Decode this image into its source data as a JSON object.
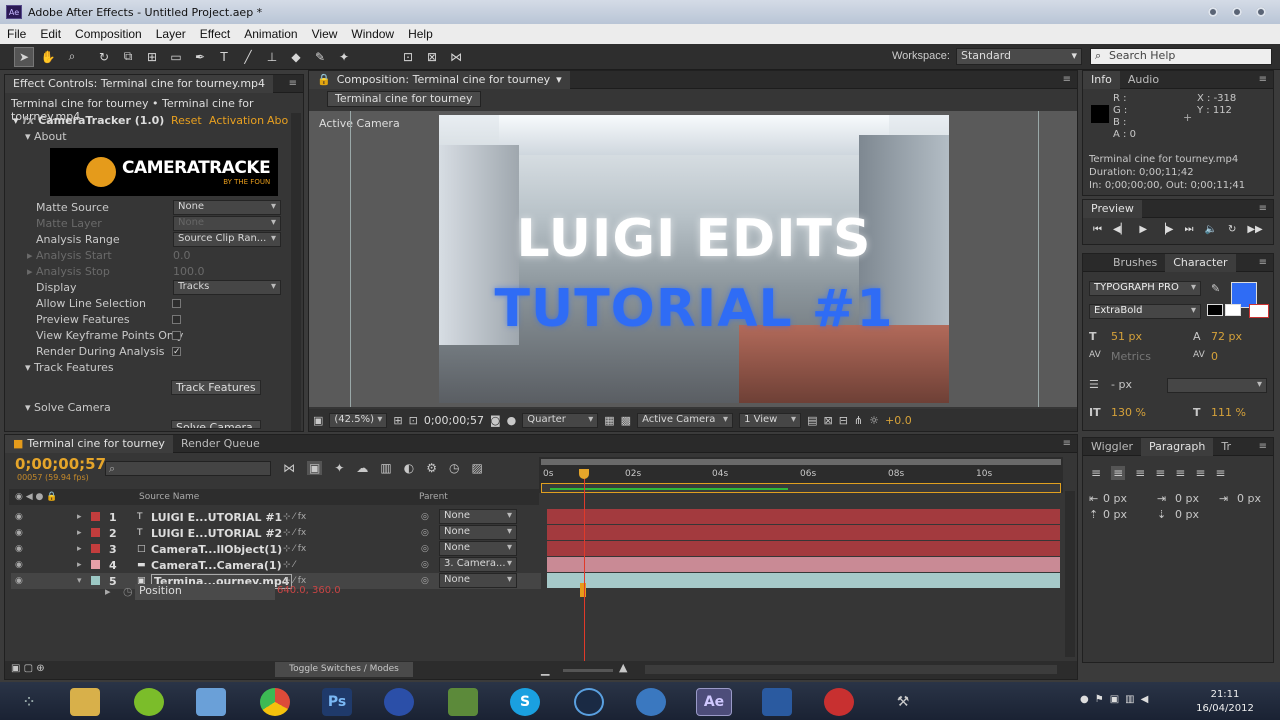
{
  "window": {
    "title": "Adobe After Effects - Untitled Project.aep *",
    "logo": "Ae"
  },
  "menu": [
    "File",
    "Edit",
    "Composition",
    "Layer",
    "Effect",
    "Animation",
    "View",
    "Window",
    "Help"
  ],
  "toolbar": {
    "workspace_label": "Workspace:",
    "workspace_value": "Standard",
    "search_placeholder": "Search Help"
  },
  "effect_controls": {
    "tab": "Effect Controls: Terminal cine for tourney.mp4",
    "breadcrumb": "Terminal cine for tourney • Terminal cine for tourney.mp4",
    "effect_name": "CameraTracker (1.0)",
    "reset": "Reset",
    "activation": "Activation",
    "about_link": "Abo",
    "about": "About",
    "banner": "CAMERATRACKE",
    "banner_sub": "BY THE FOUN",
    "props": [
      {
        "label": "Matte Source",
        "value": "None",
        "dim": false
      },
      {
        "label": "Matte Layer",
        "value": "None",
        "dim": true
      },
      {
        "label": "Analysis Range",
        "value": "Source Clip Ran...",
        "dim": false
      },
      {
        "label": "Analysis Start",
        "value": "0.0",
        "dim": true
      },
      {
        "label": "Analysis Stop",
        "value": "100.0",
        "dim": true
      },
      {
        "label": "Display",
        "value": "Tracks",
        "dim": false
      }
    ],
    "checks": [
      {
        "label": "Allow Line Selection",
        "checked": false
      },
      {
        "label": "Preview Features",
        "checked": false
      },
      {
        "label": "View Keyframe Points Only",
        "checked": false
      },
      {
        "label": "Render During Analysis",
        "checked": true
      }
    ],
    "track_features_group": "Track Features",
    "track_features_button": "Track Features",
    "solve_camera_group": "Solve Camera",
    "solve_camera_button": "Solve Camera"
  },
  "composition": {
    "tab": "Composition: Terminal cine for tourney",
    "sub_tab": "Terminal cine for tourney",
    "view_label": "Active Camera",
    "overlay_line1": "LUIGI EDITS",
    "overlay_line2": "TUTORIAL #1",
    "zoom": "(42.5%)",
    "timecode": "0;00;00;57",
    "resolution": "Quarter",
    "camera": "Active Camera",
    "views": "1 View",
    "exposure": "+0.0"
  },
  "info": {
    "tabs": [
      "Info",
      "Audio"
    ],
    "r": "R :",
    "g": "G :",
    "b": "B :",
    "a": "A : 0",
    "x": "X : -318",
    "y": "Y : 112",
    "file": "Terminal cine for tourney.mp4",
    "duration": "Duration: 0;00;11;42",
    "inout": "In: 0;00;00;00, Out: 0;00;11;41"
  },
  "preview": {
    "tab": "Preview"
  },
  "character": {
    "tabs": [
      "Brushes",
      "Character"
    ],
    "font": "TYPOGRAPH PRO",
    "style": "ExtraBold",
    "size": "51 px",
    "leading": "72 px",
    "kerning": "Metrics",
    "tracking": "0",
    "stroke": "- px",
    "vscale": "130 %",
    "hscale": "111 %",
    "fill_color": "#2f6cf5"
  },
  "paragraph": {
    "tabs": [
      "Wiggler",
      "Paragraph",
      "Tr"
    ],
    "indent_left": "0 px",
    "indent_first": "0 px",
    "indent_right": "0 px",
    "space_before": "0 px",
    "space_after": "0 px"
  },
  "timeline": {
    "tabs": [
      "Terminal cine for tourney",
      "Render Queue"
    ],
    "timecode": "0;00;00;57",
    "fps": "00057 (59.94 fps)",
    "col_source": "Source Name",
    "col_parent": "Parent",
    "ruler": [
      "0s",
      "02s",
      "04s",
      "06s",
      "08s",
      "10s"
    ],
    "layers": [
      {
        "num": "1",
        "name": "LUIGI E...UTORIAL #1",
        "parent": "None",
        "color": "#c23d3d",
        "bar": "#a33a3e"
      },
      {
        "num": "2",
        "name": "LUIGI E...UTORIAL #2",
        "parent": "None",
        "color": "#c23d3d",
        "bar": "#a33a3e"
      },
      {
        "num": "3",
        "name": "CameraT...llObject(1)",
        "parent": "None",
        "color": "#c23d3d",
        "bar": "#a33a3e"
      },
      {
        "num": "4",
        "name": "CameraT...Camera(1)",
        "parent": "3. Camera...",
        "color": "#e7a0a8",
        "bar": "#c98a95"
      },
      {
        "num": "5",
        "name": "Termina...ourney.mp4",
        "parent": "None",
        "color": "#9cc8c4",
        "bar": "#a6c9c9"
      }
    ],
    "sub_prop": "Position",
    "sub_value": "640.0, 360.0",
    "toggle_label": "Toggle Switches / Modes"
  },
  "taskbar": {
    "time": "21:11",
    "date": "16/04/2012",
    "apps": [
      "explorer",
      "spotify",
      "paint",
      "chrome",
      "Ps",
      "firefox",
      "minecraft",
      "skype",
      "steam",
      "globe",
      "Ae",
      "notepad",
      "record"
    ]
  }
}
